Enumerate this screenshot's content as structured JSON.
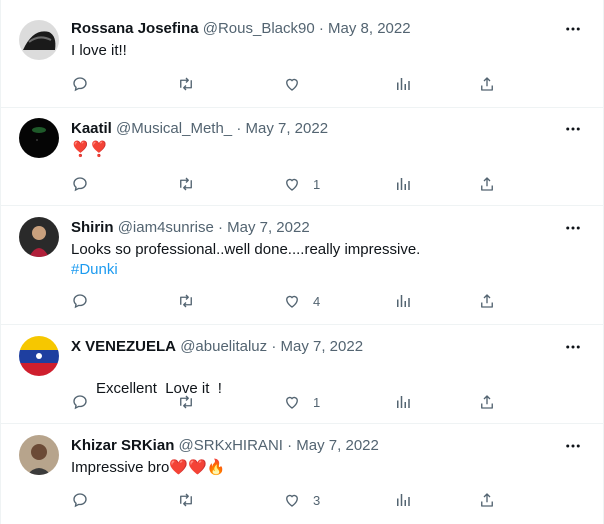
{
  "colors": {
    "text": "#0f1419",
    "muted": "#536471",
    "link": "#1d9bf0",
    "divider": "#eff3f4",
    "heart": "#dd2e44"
  },
  "icons": {
    "reply": "reply-icon",
    "retweet": "retweet-icon",
    "like": "heart-icon",
    "views": "views-icon",
    "share": "share-icon",
    "more": "more-icon"
  },
  "tweets": [
    {
      "name": "Rossana Josefina",
      "handle": "@Rous_Black90",
      "separator": "·",
      "date": "May 8, 2022",
      "text": "I love it!!",
      "likes": ""
    },
    {
      "name": "Kaatil",
      "handle": "@Musical_Meth_",
      "separator": "·",
      "date": "May 7, 2022",
      "text": "❣️❣️",
      "likes": "1"
    },
    {
      "name": "Shirin",
      "handle": "@iam4sunrise",
      "separator": "·",
      "date": "May 7, 2022",
      "text": "Looks so professional..well done....really impressive.",
      "hashtag": "#Dunki",
      "likes": "4"
    },
    {
      "name": "X VENEZUELA",
      "handle": "@abuelitaluz",
      "separator": "·",
      "date": "May 7, 2022",
      "text": "Excellent  Love it  !",
      "likes": "1"
    },
    {
      "name": "Khizar SRKian",
      "handle": "@SRKxHIRANI",
      "separator": "·",
      "date": "May 7, 2022",
      "text": "Impressive bro",
      "emoji": "❤️❤️🔥",
      "likes": "3"
    }
  ]
}
